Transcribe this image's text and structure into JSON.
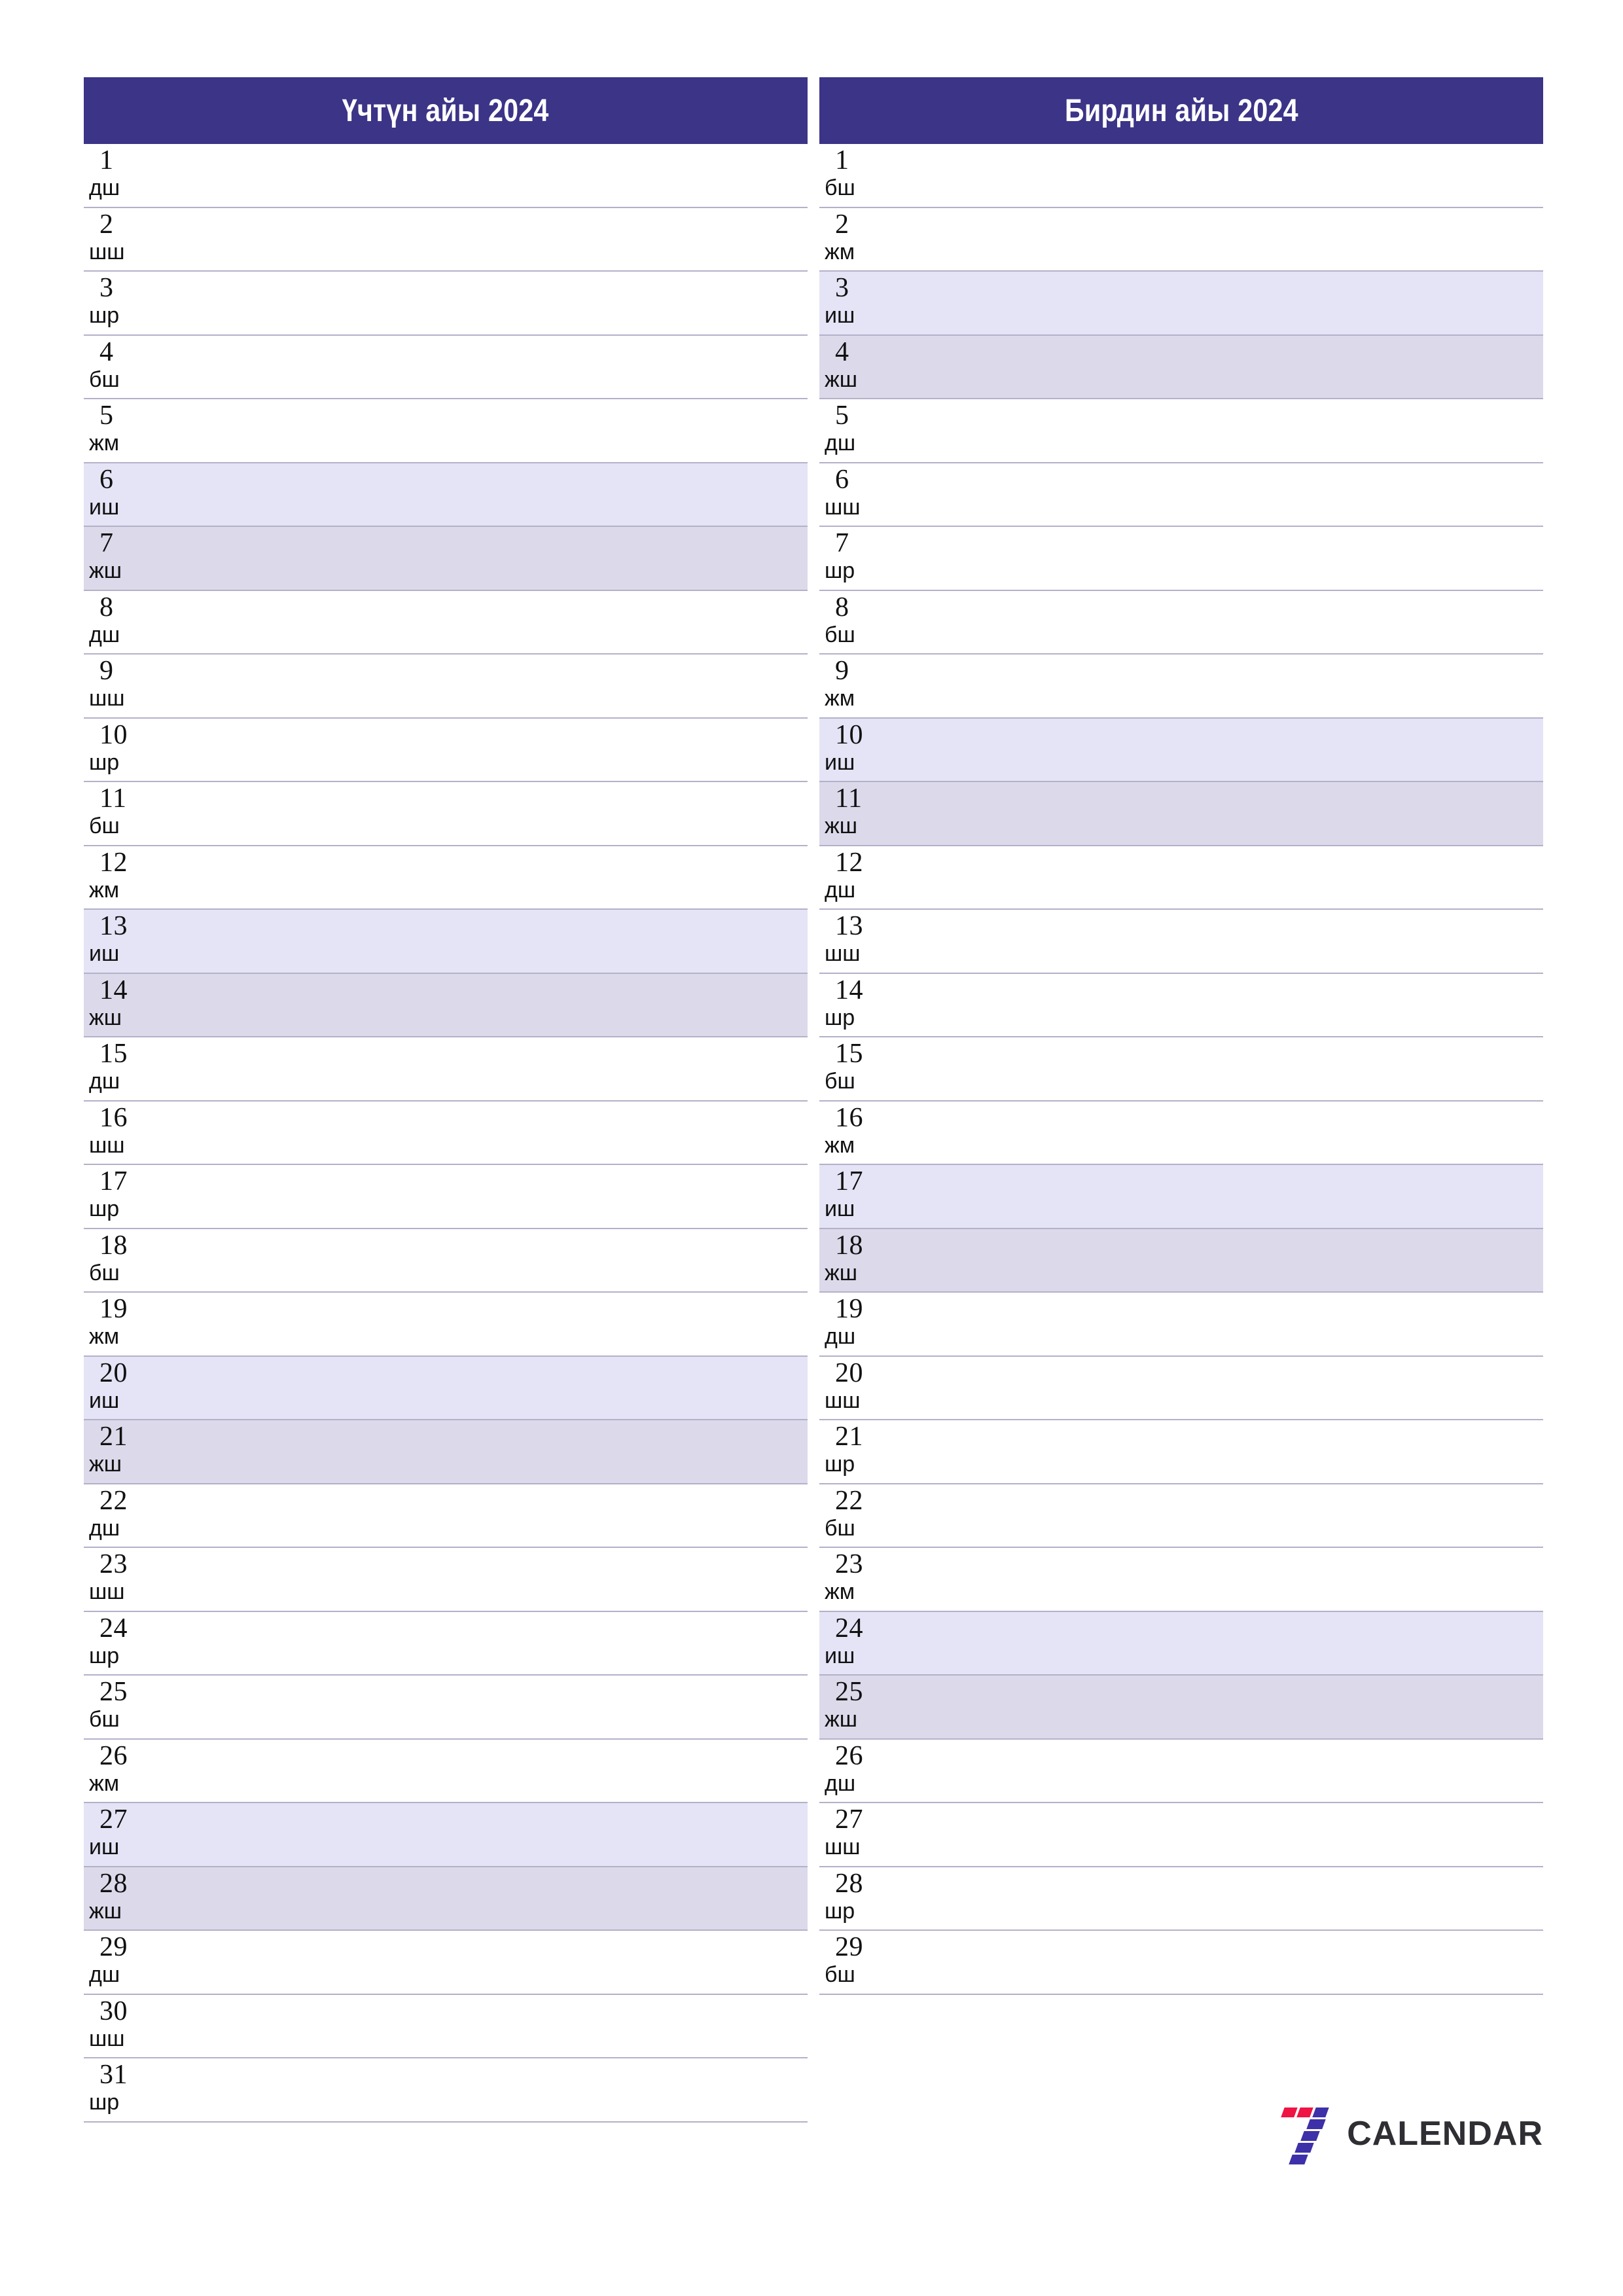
{
  "page": {
    "orientation": "portrait",
    "background": "#ffffff"
  },
  "theme": {
    "header_bg": "#3b3487",
    "header_text": "#ffffff",
    "rule_color": "#b3b1c9",
    "saturday_bg": "#e4e4f6",
    "sunday_bg": "#dcd9ea",
    "text_color": "#111111",
    "logo_red": "#ef1443",
    "logo_blue": "#3d30a8",
    "logo_text_color": "#2e2e33"
  },
  "brand": {
    "mark": "seven-logo",
    "text": "CALENDAR"
  },
  "months": [
    {
      "title": "Үчтүн айы 2024",
      "days": [
        {
          "num": "1",
          "dow": "дш",
          "type": "weekday"
        },
        {
          "num": "2",
          "dow": "шш",
          "type": "weekday"
        },
        {
          "num": "3",
          "dow": "шр",
          "type": "weekday"
        },
        {
          "num": "4",
          "dow": "бш",
          "type": "weekday"
        },
        {
          "num": "5",
          "dow": "жм",
          "type": "weekday"
        },
        {
          "num": "6",
          "dow": "иш",
          "type": "saturday"
        },
        {
          "num": "7",
          "dow": "жш",
          "type": "sunday"
        },
        {
          "num": "8",
          "dow": "дш",
          "type": "weekday"
        },
        {
          "num": "9",
          "dow": "шш",
          "type": "weekday"
        },
        {
          "num": "10",
          "dow": "шр",
          "type": "weekday"
        },
        {
          "num": "11",
          "dow": "бш",
          "type": "weekday"
        },
        {
          "num": "12",
          "dow": "жм",
          "type": "weekday"
        },
        {
          "num": "13",
          "dow": "иш",
          "type": "saturday"
        },
        {
          "num": "14",
          "dow": "жш",
          "type": "sunday"
        },
        {
          "num": "15",
          "dow": "дш",
          "type": "weekday"
        },
        {
          "num": "16",
          "dow": "шш",
          "type": "weekday"
        },
        {
          "num": "17",
          "dow": "шр",
          "type": "weekday"
        },
        {
          "num": "18",
          "dow": "бш",
          "type": "weekday"
        },
        {
          "num": "19",
          "dow": "жм",
          "type": "weekday"
        },
        {
          "num": "20",
          "dow": "иш",
          "type": "saturday"
        },
        {
          "num": "21",
          "dow": "жш",
          "type": "sunday"
        },
        {
          "num": "22",
          "dow": "дш",
          "type": "weekday"
        },
        {
          "num": "23",
          "dow": "шш",
          "type": "weekday"
        },
        {
          "num": "24",
          "dow": "шр",
          "type": "weekday"
        },
        {
          "num": "25",
          "dow": "бш",
          "type": "weekday"
        },
        {
          "num": "26",
          "dow": "жм",
          "type": "weekday"
        },
        {
          "num": "27",
          "dow": "иш",
          "type": "saturday"
        },
        {
          "num": "28",
          "dow": "жш",
          "type": "sunday"
        },
        {
          "num": "29",
          "dow": "дш",
          "type": "weekday"
        },
        {
          "num": "30",
          "dow": "шш",
          "type": "weekday"
        },
        {
          "num": "31",
          "dow": "шр",
          "type": "weekday"
        }
      ]
    },
    {
      "title": "Бирдин айы 2024",
      "days": [
        {
          "num": "1",
          "dow": "бш",
          "type": "weekday"
        },
        {
          "num": "2",
          "dow": "жм",
          "type": "weekday"
        },
        {
          "num": "3",
          "dow": "иш",
          "type": "saturday"
        },
        {
          "num": "4",
          "dow": "жш",
          "type": "sunday"
        },
        {
          "num": "5",
          "dow": "дш",
          "type": "weekday"
        },
        {
          "num": "6",
          "dow": "шш",
          "type": "weekday"
        },
        {
          "num": "7",
          "dow": "шр",
          "type": "weekday"
        },
        {
          "num": "8",
          "dow": "бш",
          "type": "weekday"
        },
        {
          "num": "9",
          "dow": "жм",
          "type": "weekday"
        },
        {
          "num": "10",
          "dow": "иш",
          "type": "saturday"
        },
        {
          "num": "11",
          "dow": "жш",
          "type": "sunday"
        },
        {
          "num": "12",
          "dow": "дш",
          "type": "weekday"
        },
        {
          "num": "13",
          "dow": "шш",
          "type": "weekday"
        },
        {
          "num": "14",
          "dow": "шр",
          "type": "weekday"
        },
        {
          "num": "15",
          "dow": "бш",
          "type": "weekday"
        },
        {
          "num": "16",
          "dow": "жм",
          "type": "weekday"
        },
        {
          "num": "17",
          "dow": "иш",
          "type": "saturday"
        },
        {
          "num": "18",
          "dow": "жш",
          "type": "sunday"
        },
        {
          "num": "19",
          "dow": "дш",
          "type": "weekday"
        },
        {
          "num": "20",
          "dow": "шш",
          "type": "weekday"
        },
        {
          "num": "21",
          "dow": "шр",
          "type": "weekday"
        },
        {
          "num": "22",
          "dow": "бш",
          "type": "weekday"
        },
        {
          "num": "23",
          "dow": "жм",
          "type": "weekday"
        },
        {
          "num": "24",
          "dow": "иш",
          "type": "saturday"
        },
        {
          "num": "25",
          "dow": "жш",
          "type": "sunday"
        },
        {
          "num": "26",
          "dow": "дш",
          "type": "weekday"
        },
        {
          "num": "27",
          "dow": "шш",
          "type": "weekday"
        },
        {
          "num": "28",
          "dow": "шр",
          "type": "weekday"
        },
        {
          "num": "29",
          "dow": "бш",
          "type": "weekday"
        }
      ]
    }
  ]
}
